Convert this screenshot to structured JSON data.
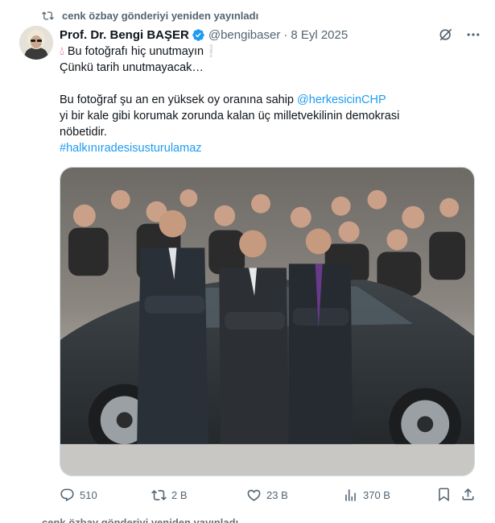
{
  "repost": {
    "label": "cenk özbay gönderiyi yeniden yayınladı",
    "icon": "repost-icon"
  },
  "author": {
    "name": "Prof. Dr. Bengi BAŞER",
    "handle": "@bengibaser",
    "separator": "·",
    "date": "8 Eyl 2025",
    "verified_color": "#1d9bf0"
  },
  "tweet": {
    "line1_text": "Bu fotoğrafı hiç unutmayın❕",
    "line2": "Çünkü tarih unutmayacak…",
    "line3_prefix": "Bu fotoğraf şu an en yüksek oy oranına sahip ",
    "line3_mention": "@herkesicinCHP",
    "line4": "yi bir kale gibi korumak zorunda kalan üç milletvekilinin demokrasi",
    "line5": "nöbetidir.",
    "hashtag": "#halkınıradesisusturulamaz"
  },
  "actions": {
    "replies": "510",
    "reposts": "2 B",
    "likes": "23 B",
    "views": "370 B"
  },
  "next_post_hint": "cenk özbay gönderiyi yeniden yayınladı",
  "colors": {
    "accent": "#1d9bf0",
    "muted": "#536471",
    "text": "#0f1419"
  }
}
